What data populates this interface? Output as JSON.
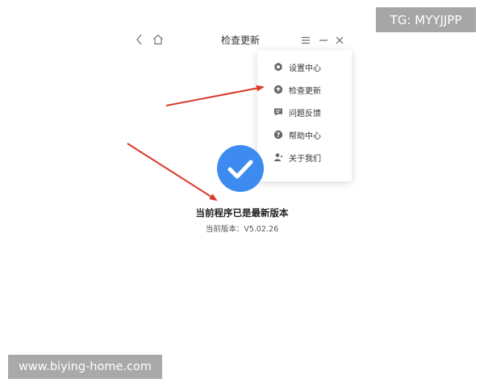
{
  "window": {
    "title": "检查更新",
    "back_icon": "chevron-left-icon",
    "home_icon": "home-icon",
    "menu_icon": "hamburger-menu-icon",
    "minimize_icon": "minimize-icon",
    "close_icon": "close-icon"
  },
  "menu": {
    "items": [
      {
        "label": "设置中心",
        "icon": "gear-icon"
      },
      {
        "label": "检查更新",
        "icon": "upload-circle-icon"
      },
      {
        "label": "问题反馈",
        "icon": "feedback-icon"
      },
      {
        "label": "帮助中心",
        "icon": "help-icon"
      },
      {
        "label": "关于我们",
        "icon": "user-icon"
      }
    ]
  },
  "status": {
    "icon": "check-circle-icon",
    "title": "当前程序已是最新版本",
    "version_text": "当前版本：V5.02.26"
  },
  "watermarks": {
    "top_right": "TG: MYYJJPP",
    "bottom_left": "www.biying-home.com"
  },
  "colors": {
    "accent_blue": "#3d8bf0",
    "arrow_red": "#d93a2b",
    "icon_gray": "#666666"
  }
}
